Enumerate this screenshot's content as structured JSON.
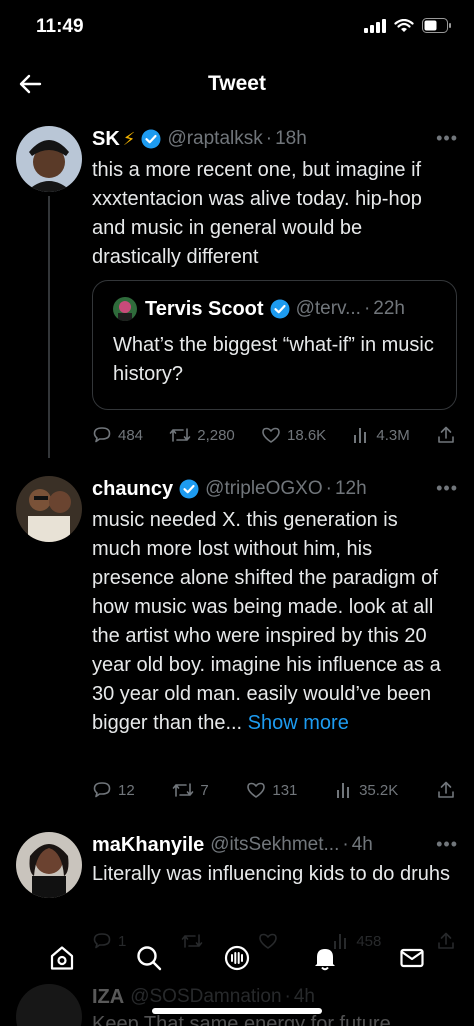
{
  "status_bar": {
    "time": "11:49"
  },
  "header": {
    "title": "Tweet"
  },
  "tweets": [
    {
      "name": "SK",
      "handle": "@raptalksk",
      "time": "18h",
      "text": "this a more recent one, but imagine if xxxtentacion was alive today. hip-hop and music in general would be drastically different",
      "quote": {
        "name": "Tervis Scoot",
        "handle": "@terv...",
        "time": "22h",
        "text": "What’s the biggest “what-if” in music history?"
      },
      "stats": {
        "replies": "484",
        "retweets": "2,280",
        "likes": "18.6K",
        "views": "4.3M"
      }
    },
    {
      "name": "chauncy",
      "handle": "@tripleOGXO",
      "time": "12h",
      "text": "music needed X. this generation is much more lost without him, his presence alone shifted the paradigm of how music was being made. look at all the artist who were inspired by this 20 year old boy. imagine his influence as a 30 year old man. easily would’ve been bigger than the...",
      "show_more": "Show more",
      "stats": {
        "replies": "12",
        "retweets": "7",
        "likes": "131",
        "views": "35.2K"
      }
    },
    {
      "name": "maKhanyile",
      "handle": "@itsSekhmet...",
      "time": "4h",
      "text": "Literally was influencing kids to do druhs",
      "stats": {
        "replies": "1",
        "retweets": "",
        "likes": "",
        "views": "458"
      }
    },
    {
      "name": "IZA",
      "handle": "@SOSDamnation",
      "time": "4h",
      "text": "Keep That same energy for future"
    }
  ],
  "icons": {
    "back": "arrow-left-icon",
    "verified": "verified-badge-icon",
    "reply": "reply-icon",
    "retweet": "retweet-icon",
    "like": "heart-icon",
    "views": "views-icon",
    "share": "share-icon",
    "nav": [
      "home-icon",
      "search-icon",
      "spaces-icon",
      "notifications-icon",
      "messages-icon"
    ]
  },
  "colors": {
    "background": "#000000",
    "accent": "#1d9bf0",
    "muted": "#71767b",
    "text": "#e7e9ea"
  }
}
